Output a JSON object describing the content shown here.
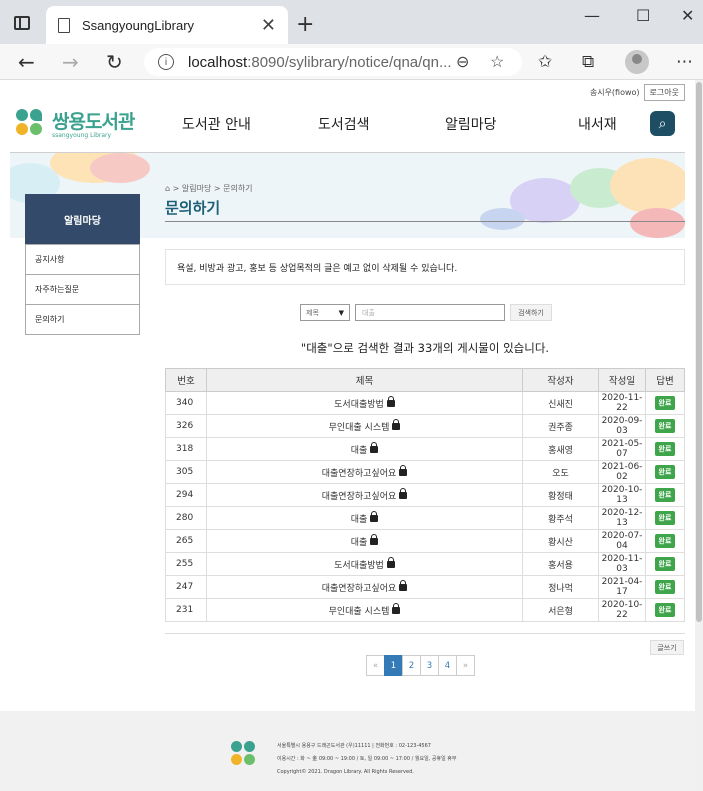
{
  "browser": {
    "tab_title": "SsangyoungLibrary",
    "url_host": "localhost",
    "url_rest": ":8090/sylibrary/notice/qna/qn...",
    "colors": {
      "tabbar": "#dee1e6",
      "addressbar": "#f7f7f7"
    }
  },
  "header": {
    "user_label": "송시우(fiowo)",
    "logout_label": "로그아웃",
    "logo_title": "쌍용도서관",
    "logo_sub": "ssangyoung Library",
    "nav": [
      "도서관 안내",
      "도서검색",
      "알림마당",
      "내서재"
    ],
    "search_icon": "search-icon"
  },
  "breadcrumb": "> 알림마당 > 문의하기",
  "page_title": "문의하기",
  "sidebar": {
    "title": "알림마당",
    "items": [
      "공지사항",
      "자주하는질문",
      "문의하기"
    ]
  },
  "notice_text": "욕설, 비방과 광고, 홍보 등 상업목적의 글은 예고 없이 삭제될 수 있습니다.",
  "search": {
    "select_value": "제목",
    "input_value": "대출",
    "button": "검색하기"
  },
  "result_text": "\"대출\"으로 검색한 결과 33개의 게시물이 있습니다.",
  "table": {
    "headers": [
      "번호",
      "제목",
      "작성자",
      "작성일",
      "답변"
    ],
    "rows": [
      {
        "no": "340",
        "title": "도서대출방법",
        "writer": "신새진",
        "date": "2020-11-22",
        "status": "완료"
      },
      {
        "no": "326",
        "title": "무인대출 시스템",
        "writer": "권주종",
        "date": "2020-09-03",
        "status": "완료"
      },
      {
        "no": "318",
        "title": "대출",
        "writer": "홍새영",
        "date": "2021-05-07",
        "status": "완료"
      },
      {
        "no": "305",
        "title": "대출연장하고싶어요",
        "writer": "오도",
        "date": "2021-06-02",
        "status": "완료"
      },
      {
        "no": "294",
        "title": "대출연장하고싶어요",
        "writer": "황정태",
        "date": "2020-10-13",
        "status": "완료"
      },
      {
        "no": "280",
        "title": "대출",
        "writer": "황주석",
        "date": "2020-12-13",
        "status": "완료"
      },
      {
        "no": "265",
        "title": "대출",
        "writer": "황시산",
        "date": "2020-07-04",
        "status": "완료"
      },
      {
        "no": "255",
        "title": "도서대출방법",
        "writer": "홍서용",
        "date": "2020-11-03",
        "status": "완료"
      },
      {
        "no": "247",
        "title": "대출연장하고싶어요",
        "writer": "정나먹",
        "date": "2021-04-17",
        "status": "완료"
      },
      {
        "no": "231",
        "title": "무인대출 시스템",
        "writer": "서은형",
        "date": "2020-10-22",
        "status": "완료"
      }
    ]
  },
  "write_button": "글쓰기",
  "pager": {
    "prev": "«",
    "pages": [
      "1",
      "2",
      "3",
      "4"
    ],
    "next": "»",
    "current": "1"
  },
  "footer": {
    "line1": "서울특별시 용용구 드래곤도서관 (우)11111 | 전화번호 : 02-123-4567",
    "line2": "이용시간 : 화 ~ 金 09:00 ~ 19:00 / 토, 일 09:00 ~ 17:00 / 월요일, 공휴일 휴무",
    "line3": "Copyright© 2021. Dragon Library. All Rights Reserved."
  },
  "colors": {
    "brand": "#3aa28e",
    "nav_dark": "#334a6b",
    "title": "#1d5f76",
    "badge": "#3ea54a",
    "pager_active": "#337ab7"
  }
}
